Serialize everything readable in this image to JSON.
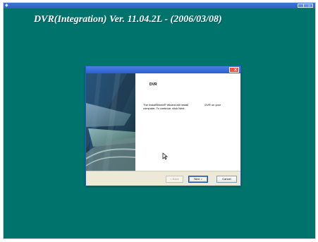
{
  "desktop": {
    "title_bar": {
      "icons": [
        "app-icon",
        "minimize-icon",
        "maximize-icon"
      ]
    },
    "heading": "DVR(Integration)  Ver. 11.04.2L - (2006/03/08)",
    "colors": {
      "background": "#00736d",
      "title_bar": "#2f60c4",
      "heading_text": "#ffffff"
    }
  },
  "wizard": {
    "product_name": "DVR",
    "message": {
      "line1_left": "The InstallShield® Wizard will install",
      "line1_right": "DVR on your",
      "line2": "computer.  To continue, click Next."
    },
    "buttons": {
      "back": "< Back",
      "next": "Next >",
      "cancel": "Cancel"
    },
    "colors": {
      "dialog_frame": "#2e56d2",
      "close_button": "#e6573b",
      "dialog_bottom": "#ece9d8"
    }
  }
}
